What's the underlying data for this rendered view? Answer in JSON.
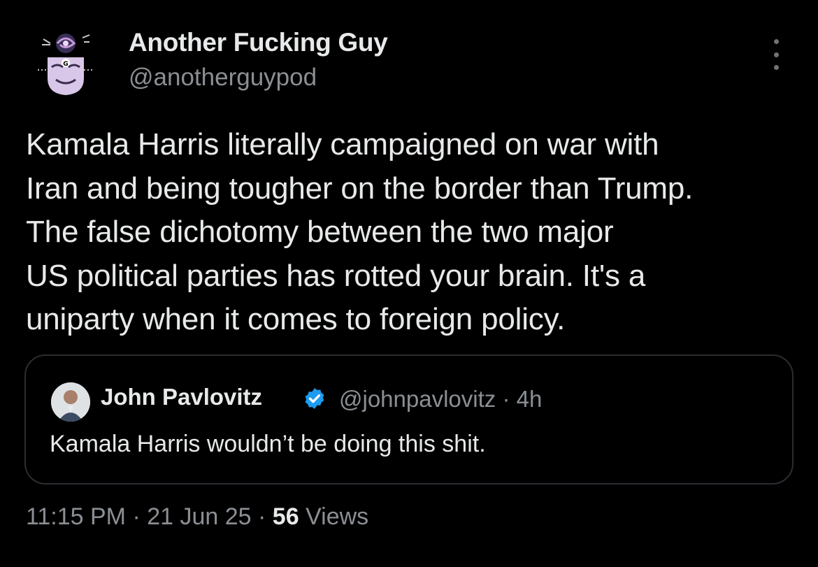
{
  "author": {
    "display_name": "Another Fucking Guy",
    "handle": "@anotherguypod",
    "avatar_icon": "masked-figure-avatar"
  },
  "more_icon": "more-vertical-icon",
  "tweet": {
    "text": "Kamala Harris literally campaigned on war with\nIran and being tougher on the border than Trump.\nThe false dichotomy between the two major\nUS political parties has rotted your brain. It's a\nuniparty when it comes to foreign policy."
  },
  "quote": {
    "display_name": "John Pavlovitz",
    "handle_time": "@johnpavlovitz · 4h",
    "text": "Kamala Harris wouldn’t be doing this shit.",
    "verified_icon": "verified-badge-icon",
    "verified_color": "#1d9bf0"
  },
  "meta": {
    "time_date": "11:15 PM · 21 Jun 25 · ",
    "views_count": "56",
    "views_label": " Views"
  },
  "colors": {
    "background": "#000000",
    "primary_text": "#e7e9ea",
    "secondary_text": "#8b8f94",
    "border": "#2a2d31"
  }
}
